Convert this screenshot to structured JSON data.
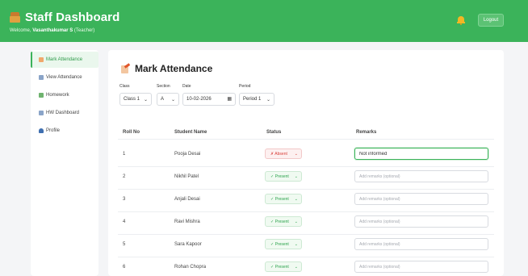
{
  "header": {
    "title": "Staff Dashboard",
    "welcome_prefix": "Welcome, ",
    "user_name": "Vasanthakumar S",
    "role": " (Teacher)",
    "logout_label": "Logout",
    "brand_icon": "school-bag-icon",
    "bell_icon": "bell-icon"
  },
  "sidebar": {
    "items": [
      {
        "label": "Mark Attendance",
        "icon": "memo-icon",
        "active": true
      },
      {
        "label": "View Attendance",
        "icon": "chart-icon",
        "active": false
      },
      {
        "label": "Homework",
        "icon": "books-icon",
        "active": false
      },
      {
        "label": "HW Dashboard",
        "icon": "chart-icon",
        "active": false
      },
      {
        "label": "Profile",
        "icon": "person-icon",
        "active": false
      }
    ]
  },
  "main": {
    "title": "Mark Attendance",
    "filters": {
      "class_label": "Class",
      "class_value": "Class 1",
      "section_label": "Section",
      "section_value": "A",
      "date_label": "Date",
      "date_value": "10-02-2026",
      "period_label": "Period",
      "period_value": "Period 1"
    },
    "table": {
      "headers": [
        "Roll No",
        "Student Name",
        "Status",
        "Remarks"
      ],
      "remarks_placeholder": "Add remarks (optional)",
      "rows": [
        {
          "roll": "1",
          "name": "Pooja Desai",
          "status": "✗ Absent",
          "state": "absent",
          "remark": "Not informed"
        },
        {
          "roll": "2",
          "name": "Nikhil Patel",
          "status": "✓ Present",
          "state": "present",
          "remark": ""
        },
        {
          "roll": "3",
          "name": "Anjali Desai",
          "status": "✓ Present",
          "state": "present",
          "remark": ""
        },
        {
          "roll": "4",
          "name": "Ravi Mishra",
          "status": "✓ Present",
          "state": "present",
          "remark": ""
        },
        {
          "roll": "5",
          "name": "Sara Kapoor",
          "status": "✓ Present",
          "state": "present",
          "remark": ""
        },
        {
          "roll": "6",
          "name": "Rohan Chopra",
          "status": "✓ Present",
          "state": "present",
          "remark": ""
        }
      ]
    }
  },
  "colors": {
    "brand": "#3bb35a",
    "present": "#2da44e",
    "absent": "#d9413b"
  }
}
